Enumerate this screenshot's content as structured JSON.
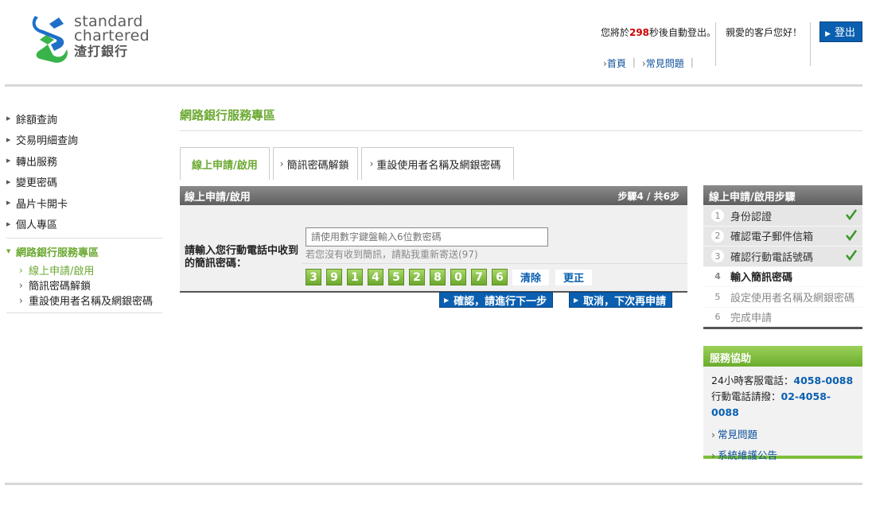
{
  "header": {
    "logo_en_line1": "standard",
    "logo_en_line2": "chartered",
    "logo_zh": "渣打銀行",
    "countdown_prefix": "您將於",
    "countdown_seconds": "298",
    "countdown_suffix": "秒後自動登出。",
    "greeting": "親愛的客戶您好！",
    "logout_label": "登出",
    "links": [
      "首頁",
      "常見問題"
    ]
  },
  "leftnav": {
    "items": [
      "餘額查詢",
      "交易明細查詢",
      "轉出服務",
      "變更密碼",
      "晶片卡開卡",
      "個人專區"
    ],
    "active_section": "網路銀行服務專區",
    "sub_items": [
      "線上申請/啟用",
      "簡訊密碼解鎖",
      "重設使用者名稱及網銀密碼"
    ]
  },
  "main": {
    "page_title": "網路銀行服務專區",
    "tabs": [
      "線上申請/啟用",
      "簡訊密碼解鎖",
      "重設使用者名稱及網銀密碼"
    ],
    "panel_title": "線上申請/啟用",
    "step_prefix": "步驟",
    "step_current": "4",
    "step_sep": " / 共",
    "step_total": "6",
    "step_suffix": "步",
    "field_label": "請輸入您行動電話中收到的簡訊密碼：",
    "input_placeholder": "請使用數字鍵盤輸入6位數密碼",
    "resend_text": "若您沒有收到簡訊，請點我重新寄送(97)",
    "keypad_digits": [
      "3",
      "9",
      "1",
      "4",
      "5",
      "2",
      "8",
      "0",
      "7",
      "6"
    ],
    "clear_label": "清除",
    "correct_label": "更正",
    "confirm_label": "確認，請進行下一步",
    "cancel_label": "取消，下次再申請"
  },
  "steps": {
    "title": "線上申請/啟用步驟",
    "items": [
      {
        "num": "1",
        "label": "身份認證",
        "status": "done"
      },
      {
        "num": "2",
        "label": "確認電子郵件信箱",
        "status": "done"
      },
      {
        "num": "3",
        "label": "確認行動電話號碼",
        "status": "done"
      },
      {
        "num": "4",
        "label": "輸入簡訊密碼",
        "status": "current"
      },
      {
        "num": "5",
        "label": "設定使用者名稱及網銀密碼",
        "status": "todo"
      },
      {
        "num": "6",
        "label": "完成申請",
        "status": "todo"
      }
    ]
  },
  "help": {
    "title": "服務協助",
    "phone_label": "24小時客服電話：",
    "phone_number": "4058-0088",
    "mobile_label": "行動電話請撥：",
    "mobile_number": "02-4058-0088",
    "links": [
      "常見問題",
      "系統維護公告"
    ]
  },
  "colors": {
    "brand_green": "#6ba932",
    "brand_blue": "#0a5fb0",
    "alert_red": "#cc0000"
  }
}
